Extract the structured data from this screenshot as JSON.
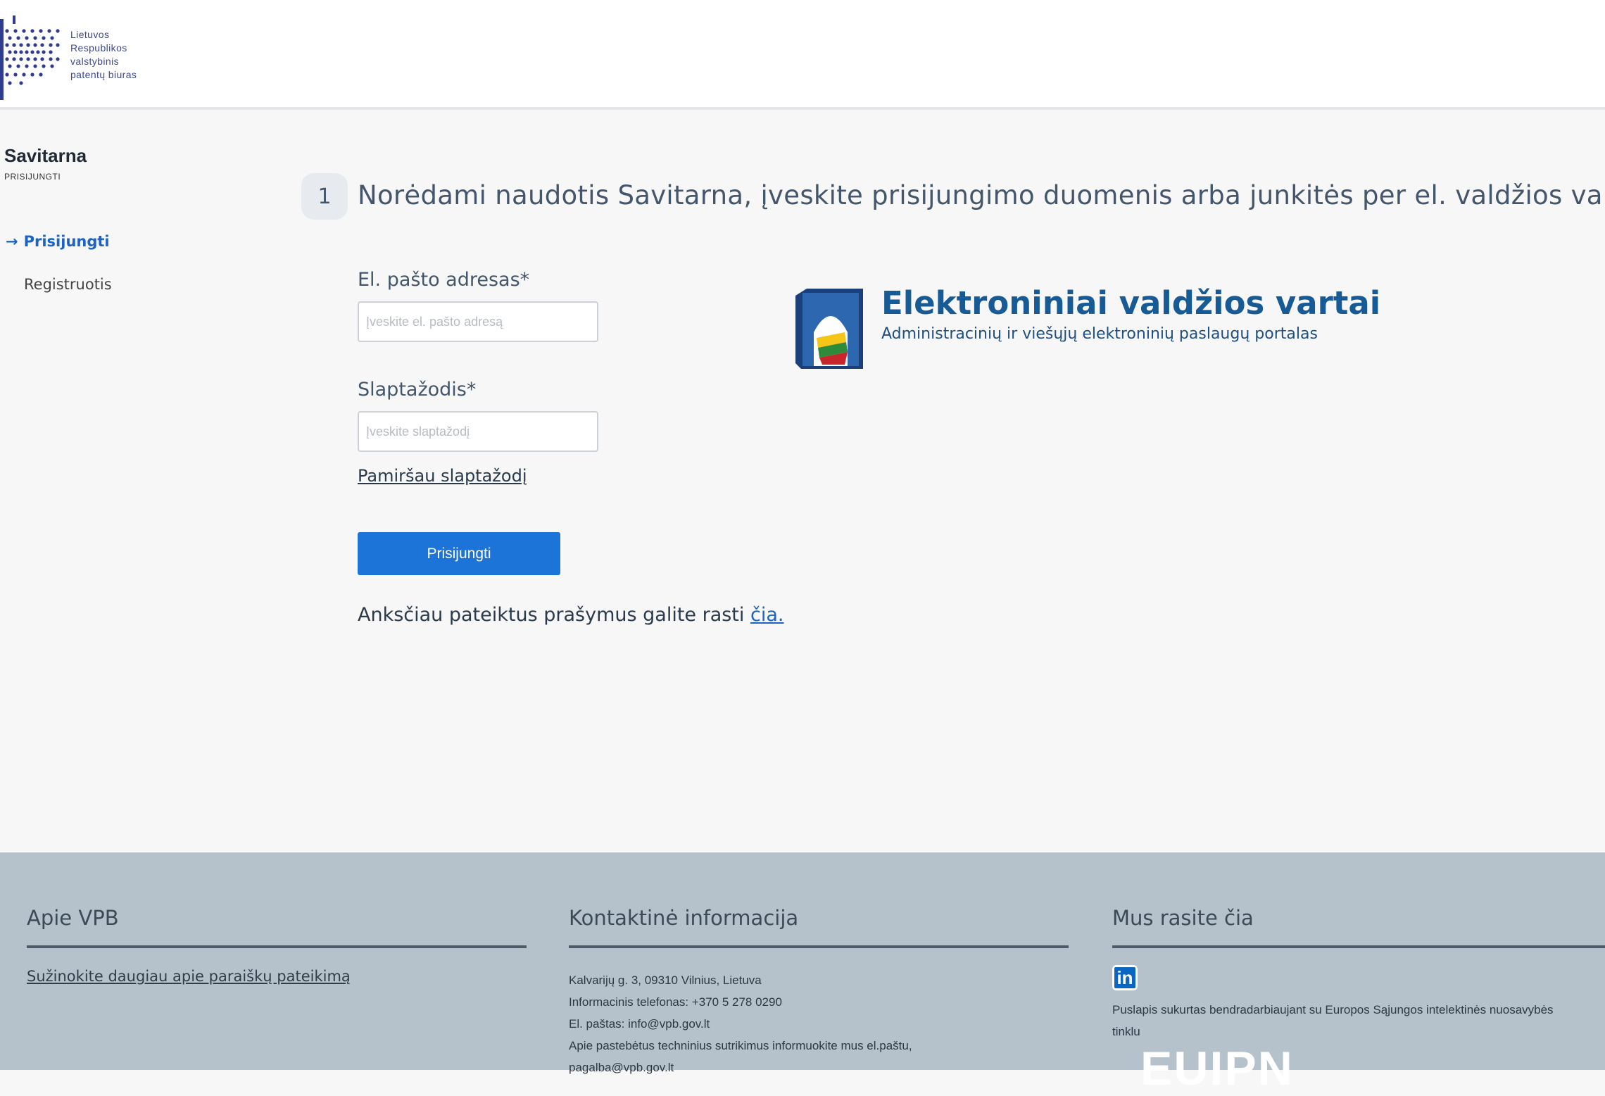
{
  "header": {
    "logo_lines": [
      "Lietuvos",
      "Respublikos",
      "valstybinis",
      "patentų biuras"
    ]
  },
  "sidebar": {
    "title": "Savitarna",
    "subtitle": "PRISIJUNGTI",
    "items": [
      {
        "label": "Prisijungti",
        "active": true
      },
      {
        "label": "Registruotis",
        "active": false
      }
    ]
  },
  "main": {
    "step_number": "1",
    "step_title": "Norėdami naudotis Savitarna, įveskite prisijungimo duomenis arba junkitės per el. valdžios var",
    "email_label": "El. pašto adresas*",
    "email_placeholder": "Įveskite el. pašto adresą",
    "password_label": "Slaptažodis*",
    "password_placeholder": "Įveskite slaptažodį",
    "forgot_label": "Pamiršau slaptažodį",
    "login_button": "Prisijungti",
    "earlier_text": "Anksčiau pateiktus prašymus galite rasti ",
    "earlier_link": "čia."
  },
  "evv": {
    "title": "Elektroniniai valdžios vartai",
    "subtitle": "Administracinių ir viešųjų elektroninių paslaugų portalas"
  },
  "footer": {
    "col1": {
      "title": "Apie VPB",
      "link": "Sužinokite daugiau apie paraiškų pateikimą"
    },
    "col2": {
      "title": "Kontaktinė informacija",
      "lines": [
        "Kalvarijų g. 3, 09310 Vilnius, Lietuva",
        "Informacinis telefonas: +370 5 278 0290",
        "El. paštas: info@vpb.gov.lt",
        "Apie pastebėtus techninius sutrikimus informuokite mus el.paštu,",
        "pagalba@vpb.gov.lt"
      ]
    },
    "col3": {
      "title": "Mus rasite čia",
      "linkedin": "in",
      "note": "Puslapis sukurtas bendradarbiaujant su Europos Sąjungos intelektinės nuosavybės tinklu",
      "network_logo": "EUIPN"
    }
  },
  "colors": {
    "primary": "#1c73d8",
    "link": "#1c63c6",
    "footer_bg": "#b5c2cb",
    "evv_blue": "#165a96"
  }
}
